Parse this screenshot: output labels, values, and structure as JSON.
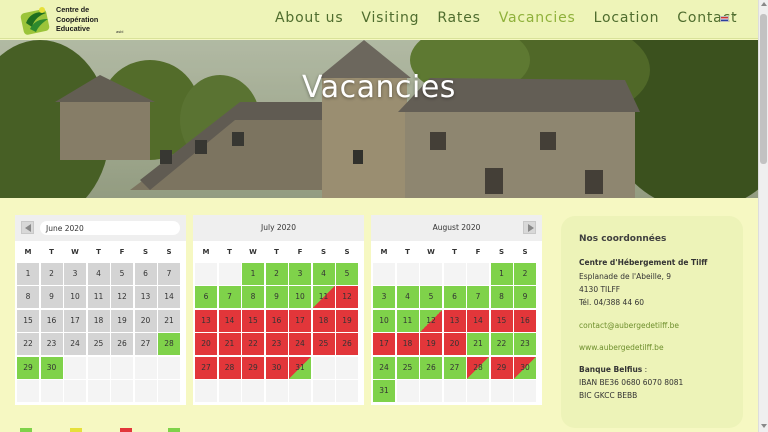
{
  "header": {
    "logo_lines": [
      "Centre de",
      "Coopération",
      "Educative"
    ],
    "logo_suffix": "asbl",
    "nav": [
      {
        "label": "About us",
        "active": false
      },
      {
        "label": "Visiting",
        "active": false
      },
      {
        "label": "Rates",
        "active": false
      },
      {
        "label": "Vacancies",
        "active": true
      },
      {
        "label": "Location",
        "active": false
      },
      {
        "label": "Contact",
        "active": false
      }
    ],
    "language": "English"
  },
  "hero": {
    "title": "Vacancies"
  },
  "colors": {
    "available": "#7fd24a",
    "booked": "#e2363a",
    "past": "#d4d4d4",
    "accent": "#8fb13b"
  },
  "weekdays": [
    "M",
    "T",
    "W",
    "T",
    "F",
    "S",
    "S"
  ],
  "calendars": [
    {
      "month": "June 2020",
      "offset": 0,
      "days": [
        "p",
        "p",
        "p",
        "p",
        "p",
        "p",
        "p",
        "p",
        "p",
        "p",
        "p",
        "p",
        "p",
        "p",
        "p",
        "p",
        "p",
        "p",
        "p",
        "p",
        "p",
        "p",
        "p",
        "p",
        "p",
        "p",
        "p",
        "g",
        "g",
        "g"
      ]
    },
    {
      "month": "July 2020",
      "offset": 2,
      "days": [
        "g",
        "g",
        "g",
        "g",
        "g",
        "g",
        "g",
        "g",
        "g",
        "g",
        "gr",
        "r",
        "r",
        "r",
        "r",
        "r",
        "r",
        "r",
        "r",
        "r",
        "r",
        "r",
        "r",
        "r",
        "r",
        "r",
        "r",
        "r",
        "r",
        "r",
        "rg"
      ]
    },
    {
      "month": "August 2020",
      "offset": 5,
      "days": [
        "g",
        "g",
        "g",
        "g",
        "g",
        "g",
        "g",
        "g",
        "g",
        "g",
        "g",
        "gr",
        "r",
        "r",
        "r",
        "r",
        "r",
        "r",
        "r",
        "r",
        "g",
        "g",
        "g",
        "g",
        "g",
        "g",
        "g",
        "rg",
        "r",
        "rg",
        "g"
      ]
    }
  ],
  "contact": {
    "title": "Nos coordonnées",
    "org": "Centre d'Hébergement de Tilff",
    "street": "Esplanade de l'Abeille, 9",
    "city": "4130 TILFF",
    "phone": "Tél. 04/388 44 60",
    "email": "contact@aubergedetilff.be",
    "website": "www.aubergedetilff.be",
    "bank_label": "Banque Belfius",
    "bank_sep": " :",
    "iban": "IBAN BE36 0680 6070 8081",
    "bic": "BIC GKCC BEBB"
  }
}
